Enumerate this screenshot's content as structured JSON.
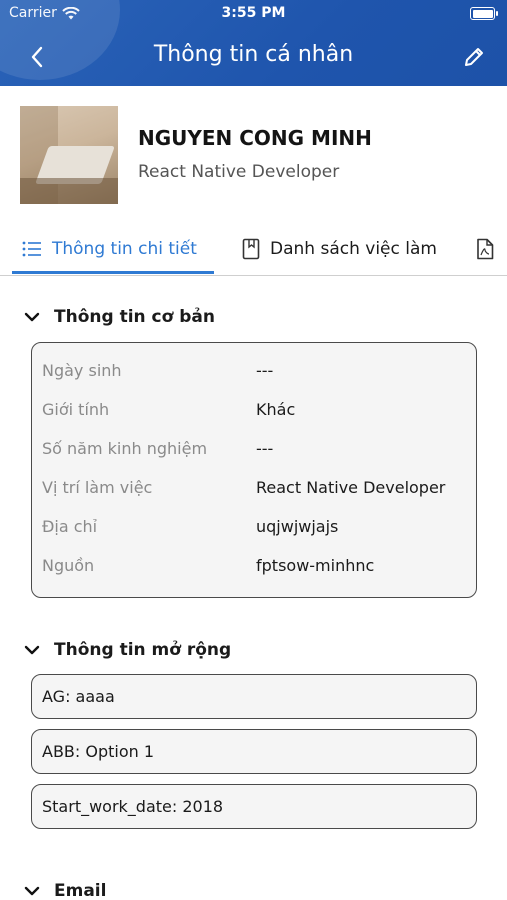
{
  "status_bar": {
    "carrier": "Carrier",
    "time": "3:55 PM"
  },
  "header": {
    "title": "Thông tin cá nhân",
    "back_icon": "chevron-left-icon",
    "edit_icon": "pencil-icon",
    "color": "#1f55ad"
  },
  "profile": {
    "name": "NGUYEN CONG MINH",
    "role": "React Native Developer"
  },
  "tabs": [
    {
      "label": "Thông tin chi tiết",
      "icon": "list-icon",
      "active": true
    },
    {
      "label": "Danh sách việc làm",
      "icon": "bookmark-icon",
      "active": false
    },
    {
      "label": "",
      "icon": "pdf-icon",
      "active": false
    }
  ],
  "accent_color": "#2f7ad3",
  "basic_info": {
    "title": "Thông tin cơ bản",
    "rows": [
      {
        "label": "Ngày sinh",
        "value": "---"
      },
      {
        "label": "Giới tính",
        "value": "Khác"
      },
      {
        "label": "Số năm kinh nghiệm",
        "value": "---"
      },
      {
        "label": "Vị trí làm việc",
        "value": "React Native Developer"
      },
      {
        "label": "Địa chỉ",
        "value": "uqjwjwjajs"
      },
      {
        "label": "Nguồn",
        "value": "fptsow-minhnc"
      }
    ]
  },
  "extended_info": {
    "title": "Thông tin mở rộng",
    "items": [
      "AG: aaaa",
      "ABB: Option 1",
      "Start_work_date: 2018"
    ]
  },
  "email_section": {
    "title": "Email"
  }
}
